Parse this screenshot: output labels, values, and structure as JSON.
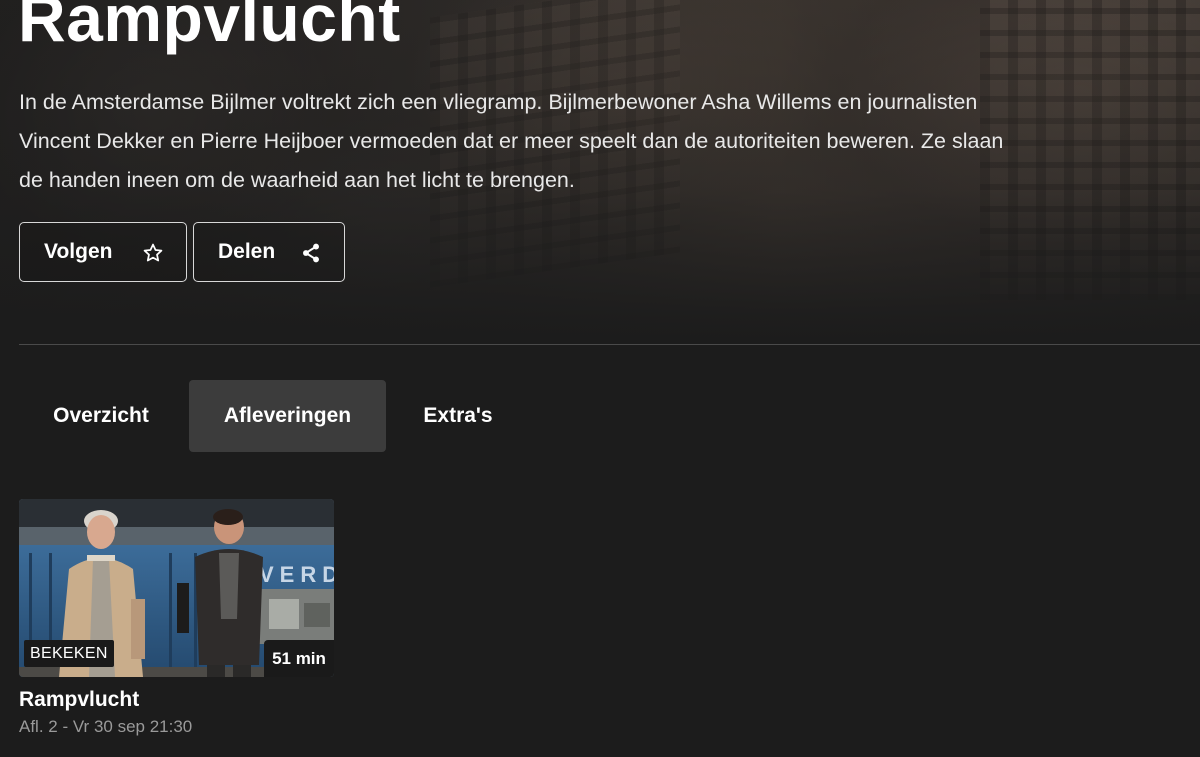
{
  "hero": {
    "title": "Rampvlucht",
    "description": "In de Amsterdamse Bijlmer voltrekt zich een vliegramp. Bijlmerbewoner Asha Willems en journalisten Vincent Dekker en Pierre Heijboer vermoeden dat er meer speelt dan de autoriteiten beweren. Ze slaan de handen ineen om de waarheid aan het licht te brengen.",
    "actions": {
      "follow_label": "Volgen",
      "follow_icon": "star-outline-icon",
      "share_label": "Delen",
      "share_icon": "share-icon"
    }
  },
  "tabs": [
    {
      "label": "Overzicht",
      "active": false
    },
    {
      "label": "Afleveringen",
      "active": true
    },
    {
      "label": "Extra's",
      "active": false
    }
  ],
  "episodes": [
    {
      "title": "Rampvlucht",
      "meta": "Afl. 2 - Vr 30 sep 21:30",
      "status_badge": "BEKEKEN",
      "duration": "51 min",
      "thumbnail_sign_text": "VERD"
    }
  ],
  "colors": {
    "background": "#1c1c1c",
    "active_tab": "#3c3c3c",
    "meta_text": "#9a9a9a",
    "divider": "#4a4a4a"
  }
}
